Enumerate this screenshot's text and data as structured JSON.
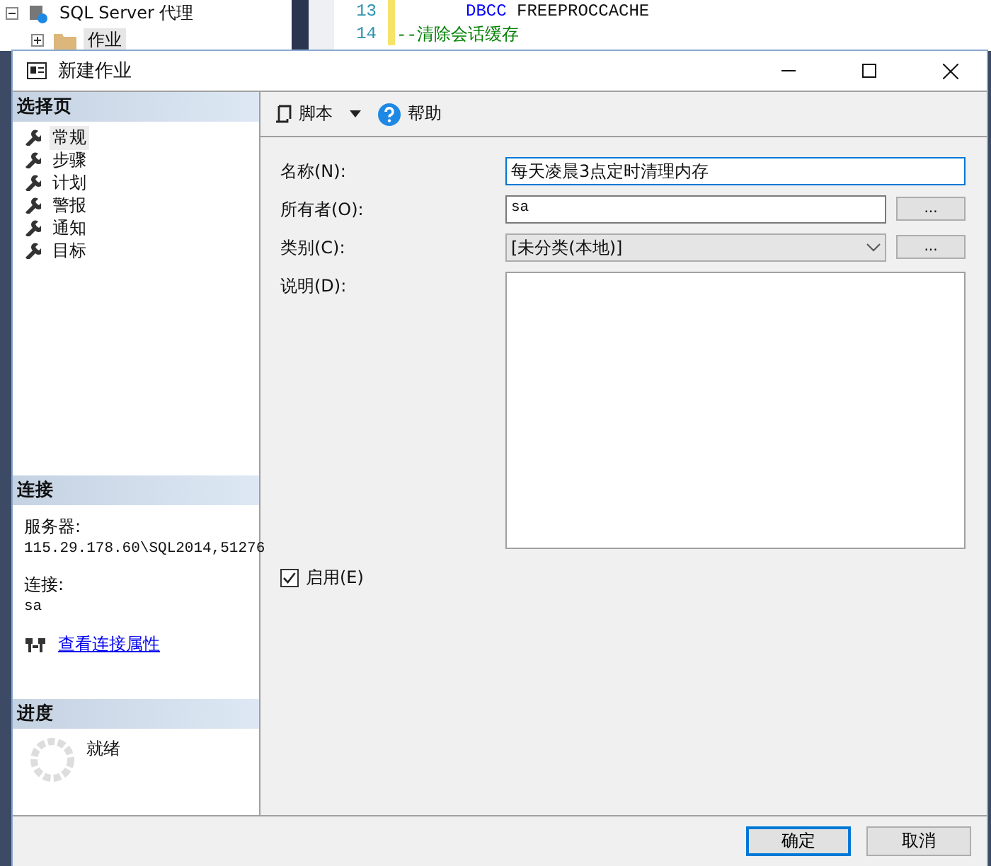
{
  "background": {
    "tree": [
      {
        "label": "SQL Server 代理",
        "expanded": true,
        "kind": "agent"
      },
      {
        "label": "作业",
        "expanded": false,
        "kind": "folder"
      }
    ],
    "code": [
      {
        "number": "13",
        "kind": "statement",
        "keyword": "DBCC",
        "text": "FREEPROCCACHE"
      },
      {
        "number": "14",
        "kind": "comment",
        "text": "--清除会话缓存"
      }
    ]
  },
  "window": {
    "title": "新建作业"
  },
  "sidebar": {
    "title": "选择页",
    "items": [
      {
        "label": "常规",
        "selected": true
      },
      {
        "label": "步骤",
        "selected": false
      },
      {
        "label": "计划",
        "selected": false
      },
      {
        "label": "警报",
        "selected": false
      },
      {
        "label": "通知",
        "selected": false
      },
      {
        "label": "目标",
        "selected": false
      }
    ]
  },
  "connection": {
    "title": "连接",
    "server_label": "服务器:",
    "server": "115.29.178.60\\SQL2014,51276",
    "login_label": "连接:",
    "login": "sa",
    "link": "查看连接属性"
  },
  "progress": {
    "title": "进度",
    "status": "就绪"
  },
  "toolbar": {
    "script": "脚本",
    "help": "帮助"
  },
  "form": {
    "fields": [
      {
        "label": "名称(N):",
        "kind": "text",
        "value": "每天凌晨3点定时清理内存",
        "focused": true
      },
      {
        "label": "所有者(O):",
        "kind": "text",
        "value": "sa",
        "focused": false,
        "browse": "..."
      },
      {
        "label": "类别(C):",
        "kind": "combo",
        "value": "[未分类(本地)]",
        "focused": false,
        "browse": "..."
      },
      {
        "label": "说明(D):",
        "kind": "textarea",
        "focused": false
      }
    ],
    "enabled": {
      "label": "启用(E)",
      "checked": true
    }
  },
  "buttons": [
    {
      "label": "确定",
      "default": true
    },
    {
      "label": "取消",
      "default": false
    }
  ]
}
